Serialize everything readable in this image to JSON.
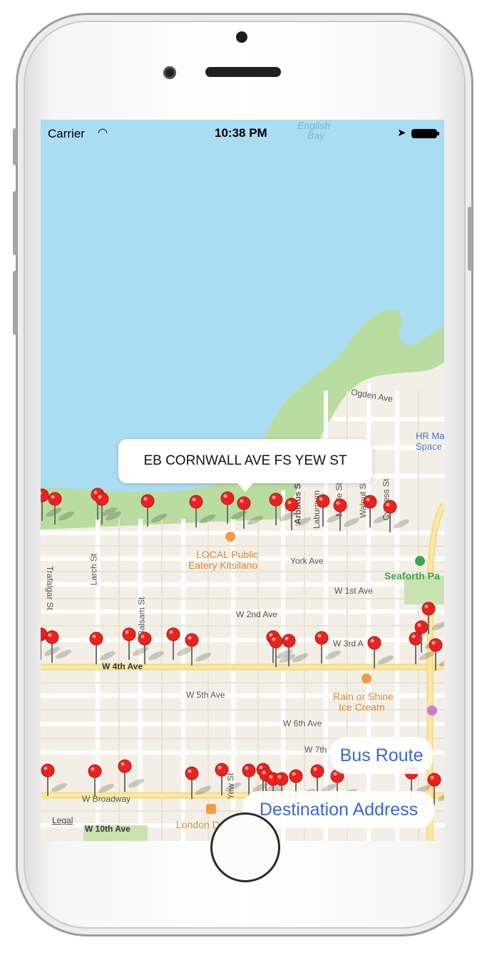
{
  "status_bar": {
    "carrier": "Carrier",
    "time": "10:38 PM"
  },
  "map": {
    "water_labels": [
      "English",
      "Bay"
    ],
    "street_labels": {
      "ogden": "Ogden Ave",
      "york": "York Ave",
      "w1st": "W 1st Ave",
      "w2nd": "W 2nd Ave",
      "w3rd": "W 3rd A",
      "w4th": "W 4th Ave",
      "w5th": "W 5th Ave",
      "w6th": "W 6th Ave",
      "w7th": "W 7th",
      "broadway": "W Broadway",
      "w10th": "W 10th Ave",
      "trafalgar": "Trafalgar St",
      "larch": "Larch St",
      "balsam": "Balsam St",
      "arbutus": "Arbutus St",
      "laburnum": "Laburnum",
      "maple": "Maple St",
      "walnut": "Walnut St",
      "cypress": "Cypress St",
      "yew": "Yew St"
    },
    "poi_labels": {
      "local1": "LOCAL Public",
      "local2": "Eatery Kitsilano",
      "rain1": "Rain or Shine",
      "rain2": "Ice Cream",
      "seaforth": "Seaforth Pa",
      "hr1": "HR Ma",
      "hr2": "Space",
      "london": "London Drugs",
      "legal": "Legal"
    },
    "callout": "EB CORNWALL AVE FS YEW ST",
    "pin_color": "#e8231f"
  },
  "buttons": {
    "bus_route": "Bus Route",
    "destination": "Destination Address"
  },
  "colors": {
    "water": "#aadcf2",
    "park": "#b9dca0",
    "land": "#f3efe6",
    "accent": "#3a66e6"
  }
}
